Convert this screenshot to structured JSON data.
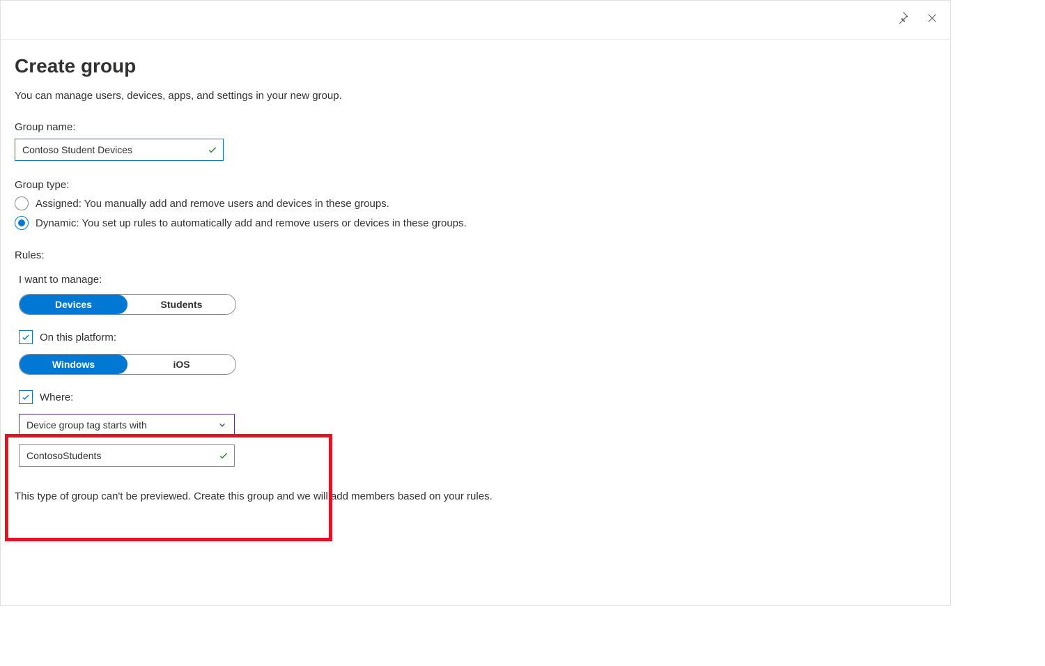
{
  "header": {
    "title": "Create group",
    "subtitle": "You can manage users, devices, apps, and settings in your new group."
  },
  "group_name": {
    "label": "Group name:",
    "value": "Contoso Student Devices"
  },
  "group_type": {
    "label": "Group type:",
    "options": {
      "assigned": "Assigned: You manually add and remove users and devices in these groups.",
      "dynamic": "Dynamic: You set up rules to automatically add and remove users or devices in these groups."
    }
  },
  "rules": {
    "label": "Rules:",
    "manage_label": "I want to manage:",
    "manage_options": {
      "devices": "Devices",
      "students": "Students"
    },
    "platform_label": "On this platform:",
    "platform_options": {
      "windows": "Windows",
      "ios": "iOS"
    },
    "where_label": "Where:",
    "where_condition": "Device group tag starts with",
    "where_value": "ContosoStudents"
  },
  "footer_note": "This type of group can't be previewed. Create this group and we will add members based on your rules."
}
